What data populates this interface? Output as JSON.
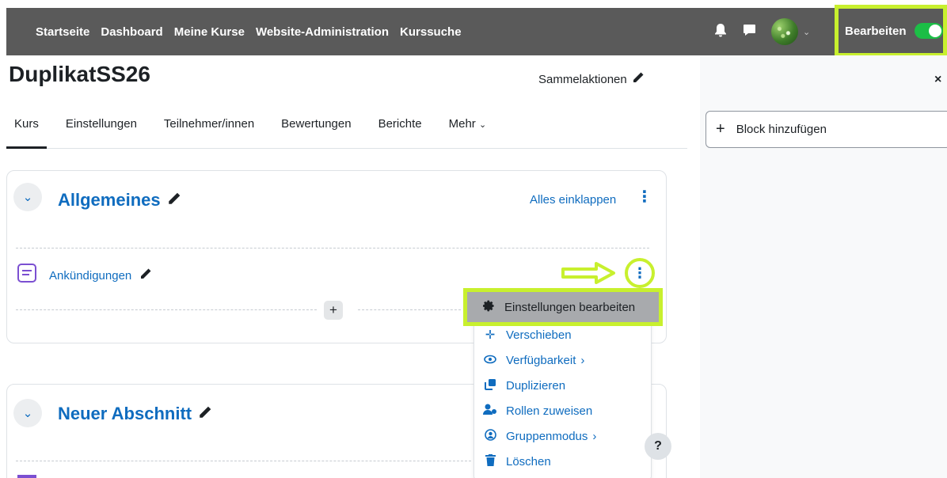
{
  "nav": {
    "links": [
      "Startseite",
      "Dashboard",
      "Meine Kurse",
      "Website-Administration",
      "Kurssuche"
    ],
    "icons": [
      "bell-icon",
      "chat-icon"
    ],
    "edit_label": "Bearbeiten",
    "edit_on": true
  },
  "page": {
    "title": "DuplikatSS26",
    "bulk_actions": "Sammelaktionen"
  },
  "tabs": [
    "Kurs",
    "Einstellungen",
    "Teilnehmer/innen",
    "Bewertungen",
    "Berichte",
    "Mehr"
  ],
  "drawer": {
    "close": "×",
    "add_block": "Block hinzufügen"
  },
  "sections": [
    {
      "title": "Allgemeines",
      "collapse_all": "Alles einklappen",
      "activity": "Ankündigungen"
    },
    {
      "title": "Neuer Abschnitt"
    }
  ],
  "menu": {
    "items": [
      {
        "label": "Einstellungen bearbeiten",
        "icon": "gear-icon"
      },
      {
        "label": "Verschieben",
        "icon": "move-icon"
      },
      {
        "label": "Verfügbarkeit",
        "icon": "eye-icon",
        "submenu": true
      },
      {
        "label": "Duplizieren",
        "icon": "duplicate-icon"
      },
      {
        "label": "Rollen zuweisen",
        "icon": "user-roles-icon"
      },
      {
        "label": "Gruppenmodus",
        "icon": "group-icon",
        "submenu": true
      },
      {
        "label": "Löschen",
        "icon": "trash-icon"
      }
    ]
  },
  "help": "?",
  "accent": "#c8f02e",
  "link_color": "#0f6cbf"
}
